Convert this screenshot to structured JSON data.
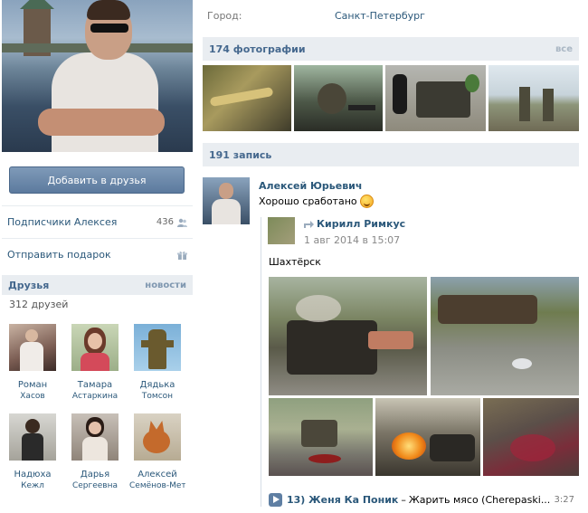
{
  "profile": {
    "add_friend_button": "Добавить в друзья",
    "followers_label": "Подписчики Алексея",
    "followers_count": "436",
    "send_gift_label": "Отправить подарок",
    "city_label": "Город:",
    "city_value": "Санкт-Петербург"
  },
  "friends": {
    "title": "Друзья",
    "news_link": "новости",
    "count_text": "312 друзей",
    "items": [
      {
        "first": "Роман",
        "last": "Хасов"
      },
      {
        "first": "Тамара",
        "last": "Астаркина"
      },
      {
        "first": "Дядька",
        "last": "Томсон"
      },
      {
        "first": "Надюха",
        "last": "Кежл"
      },
      {
        "first": "Дарья",
        "last": "Сергеевна"
      },
      {
        "first": "Алексей",
        "last": "Семёнов-Метёлкин"
      }
    ]
  },
  "photos": {
    "title": "174 фотографии",
    "all_link": "все"
  },
  "wall": {
    "title": "191 запись",
    "post": {
      "author": "Алексей Юрьевич",
      "text": "Хорошо сработано",
      "repost": {
        "author": "Кирилл Римкус",
        "date": "1 авг 2014 в 15:07",
        "text": "Шахтёрск"
      },
      "audio": {
        "artist": "13) Женя Ка Поник",
        "separator": "–",
        "title": "Жарить мясо (Cherepaski...",
        "duration": "3:27"
      }
    }
  },
  "colors": {
    "link": "#2b587a",
    "header_bg": "#e9edf1",
    "button_bg": "#5c7a9e"
  },
  "icons": [
    "friends-icon",
    "gift-icon",
    "repost-icon",
    "play-icon",
    "smile-emoji-icon"
  ]
}
